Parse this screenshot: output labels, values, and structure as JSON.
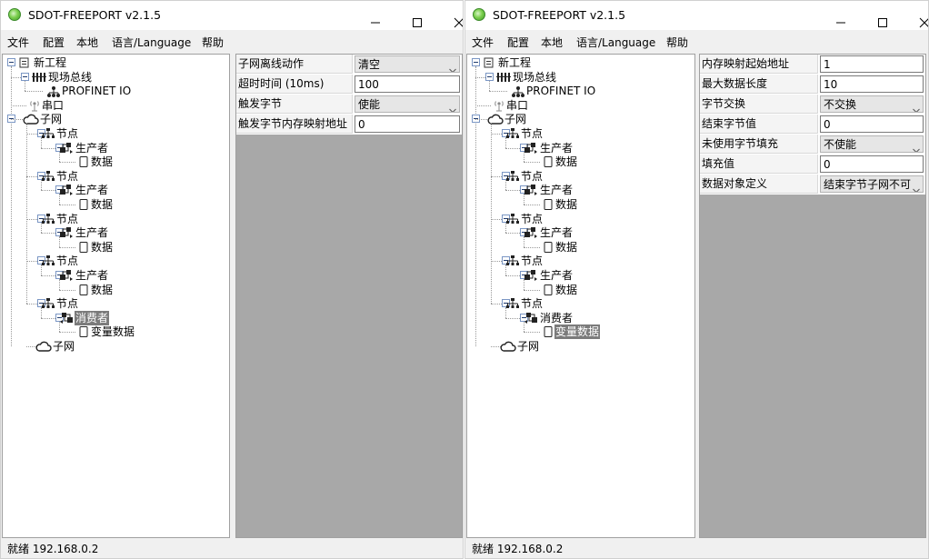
{
  "left_window": {
    "title": "SDOT-FREEPORT v2.1.5",
    "menu": [
      "文件",
      "配置",
      "本地",
      "语言/Language",
      "帮助"
    ],
    "tree": {
      "root": "新工程",
      "fieldbus": "现场总线",
      "profinet": "PROFINET IO",
      "serial": "串口",
      "subnet": "子网",
      "nodes": [
        {
          "label": "节点",
          "child": "生产者",
          "leaf": "数据"
        },
        {
          "label": "节点",
          "child": "生产者",
          "leaf": "数据"
        },
        {
          "label": "节点",
          "child": "生产者",
          "leaf": "数据"
        },
        {
          "label": "节点",
          "child": "生产者",
          "leaf": "数据"
        },
        {
          "label": "节点",
          "child": "消费者",
          "leaf": "变量数据"
        }
      ],
      "subnet2": "子网"
    },
    "props": [
      {
        "name": "子网离线动作",
        "value": "清空",
        "combo": true
      },
      {
        "name": "超时时间 (10ms)",
        "value": "100",
        "combo": false
      },
      {
        "name": "触发字节",
        "value": "使能",
        "combo": true
      },
      {
        "name": "触发字节内存映射地址",
        "value": "0",
        "combo": false
      }
    ],
    "status": "就绪  192.168.0.2"
  },
  "right_window": {
    "title": "SDOT-FREEPORT v2.1.5",
    "menu": [
      "文件",
      "配置",
      "本地",
      "语言/Language",
      "帮助"
    ],
    "tree": {
      "root": "新工程",
      "fieldbus": "现场总线",
      "profinet": "PROFINET IO",
      "serial": "串口",
      "subnet": "子网",
      "nodes": [
        {
          "label": "节点",
          "child": "生产者",
          "leaf": "数据"
        },
        {
          "label": "节点",
          "child": "生产者",
          "leaf": "数据"
        },
        {
          "label": "节点",
          "child": "生产者",
          "leaf": "数据"
        },
        {
          "label": "节点",
          "child": "生产者",
          "leaf": "数据"
        },
        {
          "label": "节点",
          "child": "消费者",
          "leaf": "变量数据"
        }
      ],
      "subnet2": "子网"
    },
    "props": [
      {
        "name": "内存映射起始地址",
        "value": "1",
        "combo": false
      },
      {
        "name": "最大数据长度",
        "value": "10",
        "combo": false
      },
      {
        "name": "字节交换",
        "value": "不交换",
        "combo": true
      },
      {
        "name": "结束字节值",
        "value": "0",
        "combo": false
      },
      {
        "name": "未使用字节填充",
        "value": "不使能",
        "combo": true
      },
      {
        "name": "填充值",
        "value": "0",
        "combo": false
      },
      {
        "name": "数据对象定义",
        "value": "结束字节子网不可",
        "combo": true
      }
    ],
    "status": "就绪  192.168.0.2"
  },
  "icons": {
    "app": "app-icon",
    "project": "project-icon",
    "fieldbus": "fieldbus-icon",
    "profinet": "network-icon",
    "serial": "antenna-icon",
    "subnet": "cloud-icon",
    "node": "node-tree-icon",
    "producer": "producer-icon",
    "consumer": "consumer-icon",
    "data": "document-icon"
  },
  "colors": {
    "selection_light": "#cce8ff",
    "selection_dark": "#7b7b7b",
    "props_background": "#a8a8a8"
  }
}
